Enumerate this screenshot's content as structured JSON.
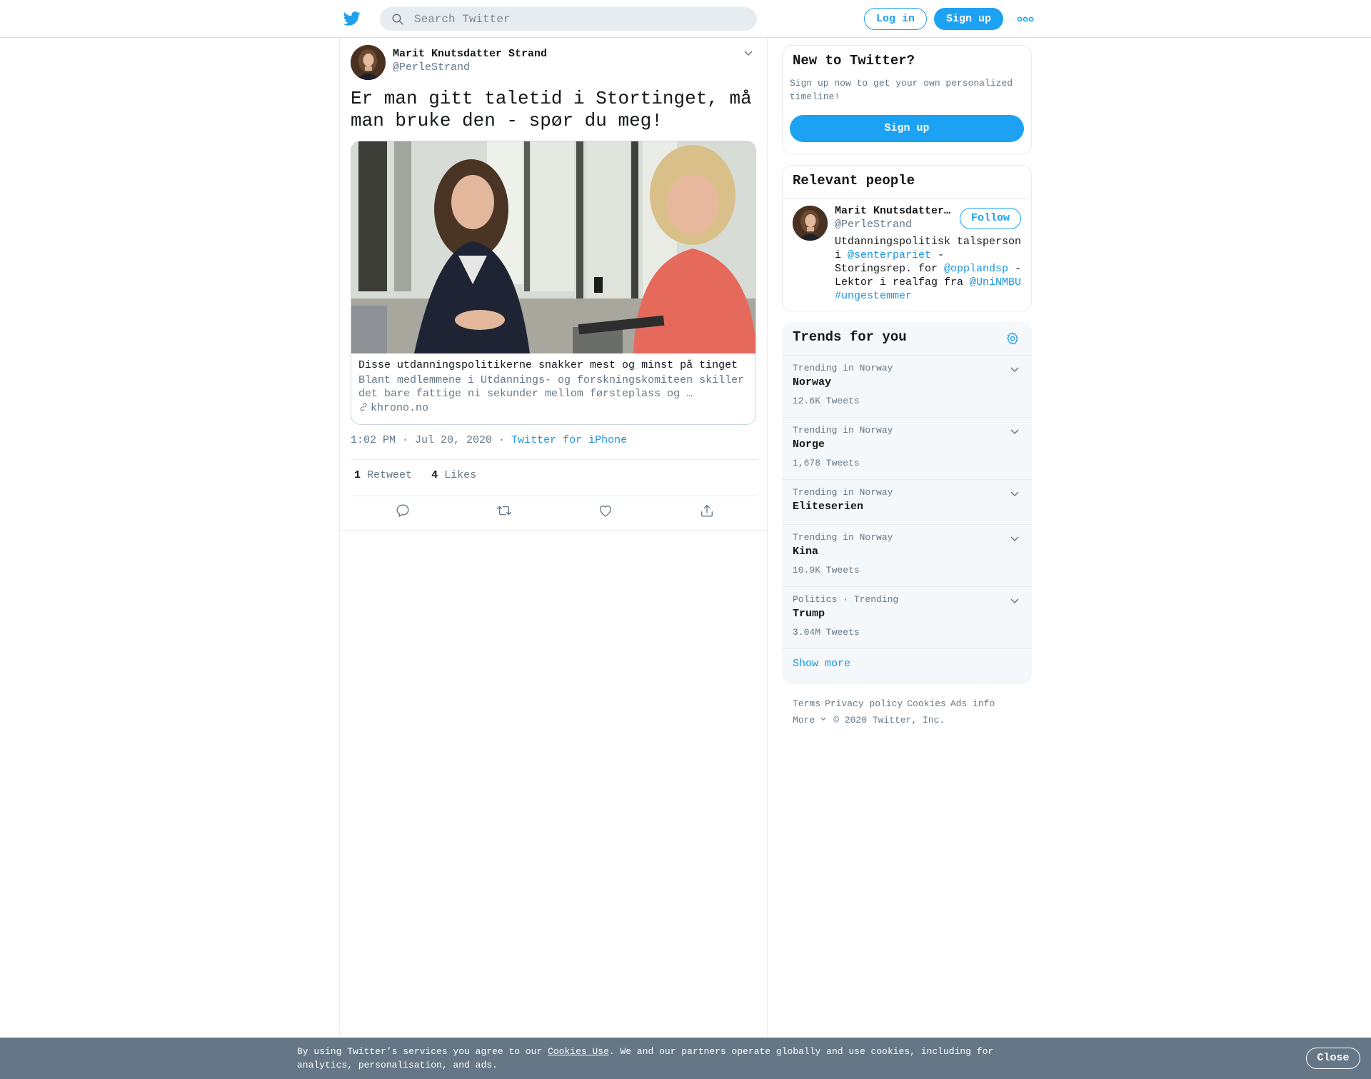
{
  "header": {
    "logo_icon": "twitter-bird-icon",
    "search_placeholder": "Search Twitter",
    "login_label": "Log in",
    "signup_label": "Sign up",
    "more_icon": "more-dots-icon"
  },
  "tweet": {
    "author_name": "Marit Knutsdatter Strand",
    "author_handle": "@PerleStrand",
    "text": "Er man gitt taletid i Stortinget, må man bruke den - spør du meg!",
    "card": {
      "title": "Disse utdanningspolitikerne snakker mest og minst på tinget",
      "description": "Blant medlemmene i Utdannings- og forskningskomiteen skiller det bare fattige ni sekunder mellom førsteplass og …",
      "domain": "khrono.no"
    },
    "time": "1:02 PM · Jul 20, 2020",
    "separator": "·",
    "source": "Twitter for iPhone",
    "retweet_count": "1",
    "retweet_label": "Retweet",
    "like_count": "4",
    "like_label": "Likes",
    "actions": [
      "reply-icon",
      "retweet-icon",
      "like-icon",
      "share-icon"
    ]
  },
  "sidebar": {
    "new_to_twitter": {
      "title": "New to Twitter?",
      "description": "Sign up now to get your own personalized timeline!",
      "button": "Sign up"
    },
    "relevant_people": {
      "title": "Relevant people",
      "name": "Marit Knutsdatter Strand",
      "handle": "@PerleStrand",
      "follow_label": "Follow",
      "bio_1": "Utdanningspolitisk talsperson i ",
      "bio_link_1": "@senterpariet",
      "bio_2": " - Storingsrep. for ",
      "bio_link_2": "@opplandsp",
      "bio_3": " - Lektor i realfag fra ",
      "bio_link_3": "@UniNMBU",
      "bio_4": " ",
      "bio_link_4": "#ungestemmer"
    },
    "trends": {
      "title": "Trends for you",
      "items": [
        {
          "context": "Trending in Norway",
          "name": "Norway",
          "count": "12.6K Tweets"
        },
        {
          "context": "Trending in Norway",
          "name": "Norge",
          "count": "1,678 Tweets"
        },
        {
          "context": "Trending in Norway",
          "name": "Eliteserien",
          "count": ""
        },
        {
          "context": "Trending in Norway",
          "name": "Kina",
          "count": "10.9K Tweets"
        },
        {
          "context": "Politics · Trending",
          "name": "Trump",
          "count": "3.04M Tweets"
        }
      ],
      "show_more": "Show more"
    },
    "footer": {
      "terms": "Terms",
      "privacy": "Privacy policy",
      "cookies": "Cookies",
      "ads": "Ads info",
      "more": "More",
      "copyright": "© 2020 Twitter, Inc."
    }
  },
  "cookie_banner": {
    "text_before": "By using Twitter’s services you agree to our ",
    "link": "Cookies Use",
    "text_after": ". We and our partners operate globally and use cookies, including for analytics, personalisation, and ads.",
    "close_label": "Close"
  },
  "colors": {
    "accent": "#1da1f2",
    "link": "#1b95e0",
    "muted": "#657786",
    "cookie_bg": "#657786"
  }
}
